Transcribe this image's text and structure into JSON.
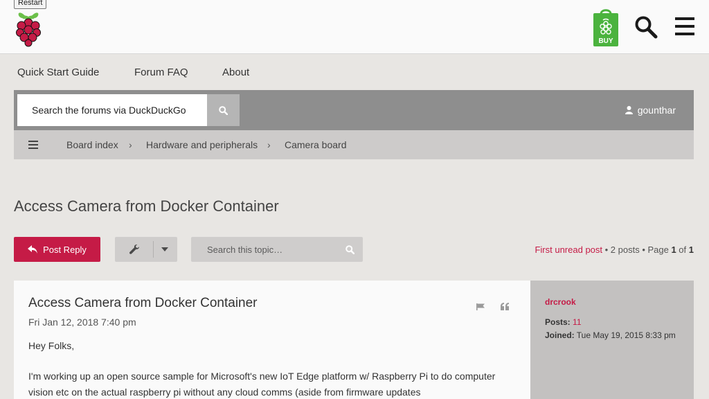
{
  "header": {
    "restart_tooltip": "Restart",
    "buy_label": "BUY",
    "colors": {
      "raspberry": "#c51b46",
      "leaf": "#6cc04a",
      "buy": "#4bb33e"
    }
  },
  "nav": {
    "items": [
      "Quick Start Guide",
      "Forum FAQ",
      "About"
    ]
  },
  "searchbar": {
    "placeholder": "Search the forums via DuckDuckGo",
    "username": "gounthar"
  },
  "breadcrumb": {
    "items": [
      "Board index",
      "Hardware and peripherals",
      "Camera board"
    ],
    "separator": "›"
  },
  "topic": {
    "title": "Access Camera from Docker Container"
  },
  "actions": {
    "post_reply_label": "Post Reply",
    "topic_search_placeholder": "Search this topic…"
  },
  "pagination": {
    "first_unread": "First unread post",
    "post_count_text": " • 2 posts • Page ",
    "page_current": "1",
    "of_text": " of ",
    "page_total": "1"
  },
  "post": {
    "title": "Access Camera from Docker Container",
    "date": "Fri Jan 12, 2018 7:40 pm",
    "body": [
      "Hey Folks,",
      "I'm working up an open source sample for Microsoft's new IoT Edge platform w/ Raspberry Pi to do computer vision etc on the actual raspberry pi without any cloud comms (aside from firmware updates"
    ]
  },
  "author": {
    "name": "drcrook",
    "posts_label": "Posts:",
    "posts_value": "11",
    "joined_label": "Joined:",
    "joined_value": "Tue May 19, 2015 8:33 pm"
  }
}
